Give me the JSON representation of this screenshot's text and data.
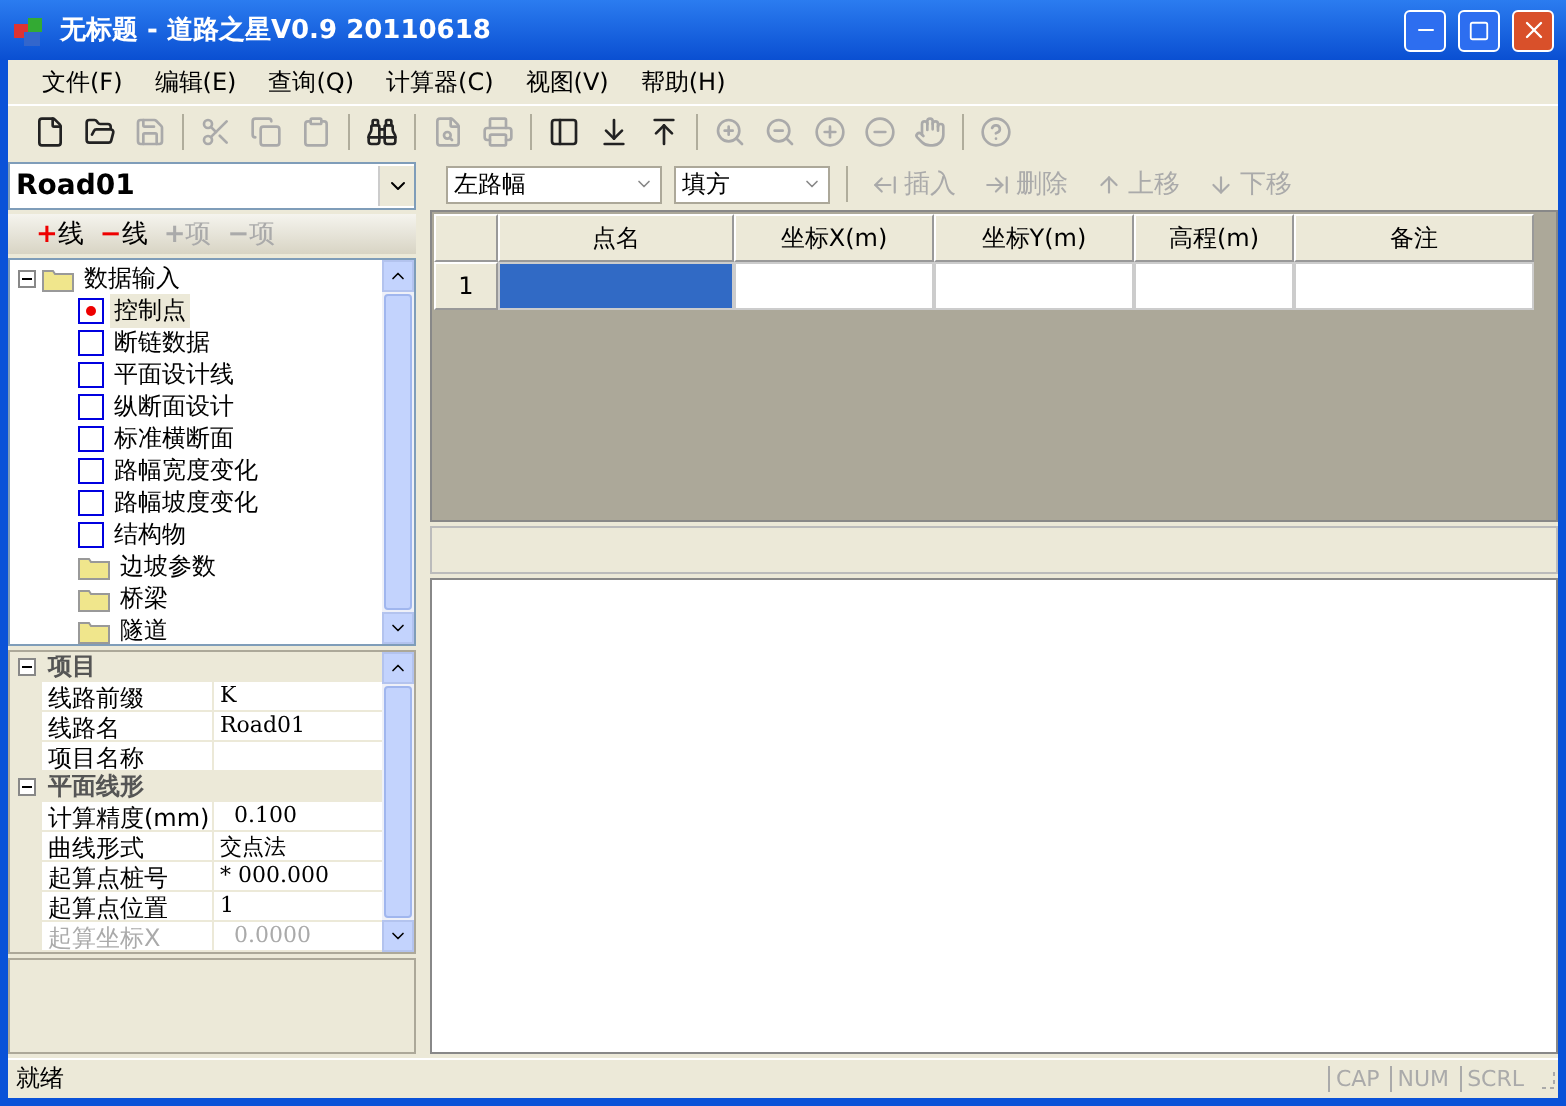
{
  "window": {
    "title": "无标题 - 道路之星V0.9 20110618"
  },
  "menu": [
    "文件(F)",
    "编辑(E)",
    "查询(Q)",
    "计算器(C)",
    "视图(V)",
    "帮助(H)"
  ],
  "toolbar": [
    {
      "kind": "new",
      "disabled": false
    },
    {
      "kind": "open",
      "disabled": false
    },
    {
      "kind": "save",
      "disabled": true
    },
    {
      "kind": "sep"
    },
    {
      "kind": "cut",
      "disabled": true
    },
    {
      "kind": "copy",
      "disabled": true
    },
    {
      "kind": "paste",
      "disabled": true
    },
    {
      "kind": "sep"
    },
    {
      "kind": "find",
      "disabled": false
    },
    {
      "kind": "sep"
    },
    {
      "kind": "preview",
      "disabled": true
    },
    {
      "kind": "print",
      "disabled": true
    },
    {
      "kind": "sep"
    },
    {
      "kind": "layout",
      "disabled": false
    },
    {
      "kind": "down",
      "disabled": false
    },
    {
      "kind": "up",
      "disabled": false
    },
    {
      "kind": "sep"
    },
    {
      "kind": "zoomfit",
      "disabled": true
    },
    {
      "kind": "zoomout",
      "disabled": true
    },
    {
      "kind": "zoomin",
      "disabled": true
    },
    {
      "kind": "zoomminus",
      "disabled": true
    },
    {
      "kind": "pan",
      "disabled": true
    },
    {
      "kind": "sep"
    },
    {
      "kind": "help",
      "disabled": true
    }
  ],
  "route_select": {
    "value": "Road01"
  },
  "tree_toolbar": [
    {
      "symbol": "+",
      "label": "线",
      "disabled": false
    },
    {
      "symbol": "−",
      "label": "线",
      "disabled": false
    },
    {
      "symbol": "+",
      "label": "项",
      "disabled": true
    },
    {
      "symbol": "−",
      "label": "项",
      "disabled": true
    }
  ],
  "tree": [
    {
      "label": "数据输入",
      "kind": "folder",
      "expanded": true,
      "children": [
        {
          "label": "控制点",
          "kind": "check",
          "checked": true,
          "selected": true
        },
        {
          "label": "断链数据",
          "kind": "check",
          "checked": false,
          "selected": false
        },
        {
          "label": "平面设计线",
          "kind": "check",
          "checked": false,
          "selected": false
        },
        {
          "label": "纵断面设计",
          "kind": "check",
          "checked": false,
          "selected": false
        },
        {
          "label": "标准横断面",
          "kind": "check",
          "checked": false,
          "selected": false
        },
        {
          "label": "路幅宽度变化",
          "kind": "check",
          "checked": false,
          "selected": false
        },
        {
          "label": "路幅坡度变化",
          "kind": "check",
          "checked": false,
          "selected": false
        },
        {
          "label": "结构物",
          "kind": "check",
          "checked": false,
          "selected": false
        },
        {
          "label": "边坡参数",
          "kind": "folder",
          "selected": false
        },
        {
          "label": "桥梁",
          "kind": "folder",
          "selected": false
        },
        {
          "label": "隧道",
          "kind": "folder",
          "selected": false
        }
      ]
    }
  ],
  "properties": [
    {
      "name": "项目",
      "expanded": true,
      "rows": [
        {
          "name": "线路前缀",
          "value": "K",
          "disabled": false
        },
        {
          "name": "线路名",
          "value": "Road01",
          "disabled": false
        },
        {
          "name": "项目名称",
          "disabled": false
        }
      ]
    },
    {
      "name": "平面线形",
      "expanded": true,
      "rows": [
        {
          "name": "计算精度(mm)",
          "value": "  0.100",
          "disabled": false
        },
        {
          "name": "曲线形式",
          "value": "交点法",
          "disabled": false
        },
        {
          "name": "起算点桩号",
          "value": "* 000.000",
          "disabled": false
        },
        {
          "name": "起算点位置",
          "value": "1",
          "disabled": false
        },
        {
          "name": "起算坐标X",
          "value": "  0.0000",
          "disabled": true
        }
      ]
    }
  ],
  "grid_toolbar": {
    "side": "左路幅",
    "fill": "填方",
    "actions": [
      {
        "kind": "insert",
        "label": "插入",
        "disabled": true
      },
      {
        "kind": "delete",
        "label": "删除",
        "disabled": true
      },
      {
        "kind": "moveup",
        "label": "上移",
        "disabled": true
      },
      {
        "kind": "movedown",
        "label": "下移",
        "disabled": true
      }
    ]
  },
  "table": {
    "columns": [
      "点名",
      "坐标X(m)",
      "坐标Y(m)",
      "高程(m)",
      "备注"
    ],
    "rows": [
      {
        "number": "1",
        "cells": [
          {
            "selected": true
          },
          {
            "selected": false
          },
          {
            "selected": false
          },
          {
            "selected": false
          },
          {
            "selected": false
          }
        ]
      }
    ]
  },
  "status_bar": {
    "text": "就绪",
    "indicators": [
      {
        "label": "CAP",
        "on": false
      },
      {
        "label": "NUM",
        "on": false
      },
      {
        "label": "SCRL",
        "on": false
      }
    ]
  }
}
